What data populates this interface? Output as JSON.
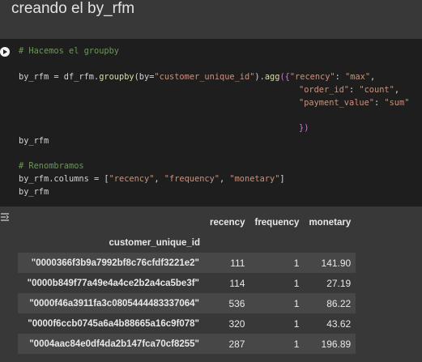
{
  "heading": "creando el by_rfm",
  "code": {
    "comment1": "# Hacemos el groupby",
    "line1_prefix": "by_rfm = df_rfm.",
    "line1_fn1": "groupby",
    "line1_mid1": "(by=",
    "line1_str1": "\"customer_unique_id\"",
    "line1_mid2": ").",
    "line1_fn2": "agg",
    "line1_mid3": "({",
    "line1_str2": "\"recency\"",
    "line1_mid4": ": ",
    "line1_str3": "\"max\"",
    "line1_end": ",",
    "line2_str1": "\"order_id\"",
    "line2_mid": ": ",
    "line2_str2": "\"count\"",
    "line2_end": ",",
    "line3_str1": "\"payment_value\"",
    "line3_mid": ": ",
    "line3_str2": "\"sum\"",
    "line4": "})",
    "line5": "by_rfm",
    "comment2": "# Renombramos",
    "line6_prefix": "by_rfm.columns = [",
    "line6_str1": "\"recency\"",
    "line6_sep1": ", ",
    "line6_str2": "\"frequency\"",
    "line6_sep2": ", ",
    "line6_str3": "\"monetary\"",
    "line6_end": "]",
    "line7": "by_rfm"
  },
  "table": {
    "columns": [
      "recency",
      "frequency",
      "monetary"
    ],
    "index_name": "customer_unique_id",
    "rows": [
      {
        "id": "\"0000366f3b9a7992bf8c76cfdf3221e2\"",
        "recency": "111",
        "frequency": "1",
        "monetary": "141.90"
      },
      {
        "id": "\"0000b849f77a49e4a4ce2b2a4ca5be3f\"",
        "recency": "114",
        "frequency": "1",
        "monetary": "27.19"
      },
      {
        "id": "\"0000f46a3911fa3c0805444483337064\"",
        "recency": "536",
        "frequency": "1",
        "monetary": "86.22"
      },
      {
        "id": "\"0000f6ccb0745a6a4b88665a16c9f078\"",
        "recency": "320",
        "frequency": "1",
        "monetary": "43.62"
      },
      {
        "id": "\"0004aac84e0df4da2b147fca70cf8255\"",
        "recency": "287",
        "frequency": "1",
        "monetary": "196.89"
      }
    ]
  },
  "icons": {
    "run": "play-circle-icon",
    "output": "output-toggle-icon"
  }
}
